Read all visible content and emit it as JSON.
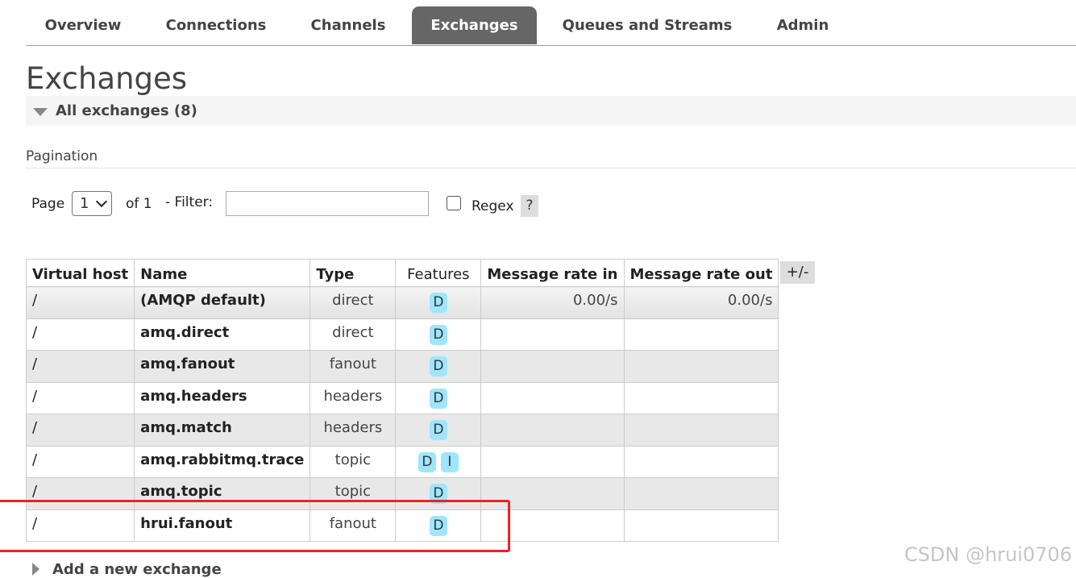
{
  "nav": {
    "tabs": [
      {
        "label": "Overview",
        "active": false
      },
      {
        "label": "Connections",
        "active": false
      },
      {
        "label": "Channels",
        "active": false
      },
      {
        "label": "Exchanges",
        "active": true
      },
      {
        "label": "Queues and Streams",
        "active": false
      },
      {
        "label": "Admin",
        "active": false
      }
    ]
  },
  "page": {
    "title": "Exchanges",
    "section_label": "All exchanges (8)"
  },
  "pagination": {
    "heading": "Pagination",
    "page_label": "Page",
    "page_value": "1",
    "of_label": "of 1",
    "filter_label": "- Filter:",
    "filter_value": "",
    "regex_label": "Regex",
    "regex_checked": false,
    "help_label": "?"
  },
  "table": {
    "headers": {
      "vhost": "Virtual host",
      "name": "Name",
      "type": "Type",
      "features": "Features",
      "rate_in": "Message rate in",
      "rate_out": "Message rate out"
    },
    "columns_toggle": "+/-",
    "rows": [
      {
        "vhost": "/",
        "name": "(AMQP default)",
        "type": "direct",
        "features": [
          "D"
        ],
        "rate_in": "0.00/s",
        "rate_out": "0.00/s"
      },
      {
        "vhost": "/",
        "name": "amq.direct",
        "type": "direct",
        "features": [
          "D"
        ],
        "rate_in": "",
        "rate_out": ""
      },
      {
        "vhost": "/",
        "name": "amq.fanout",
        "type": "fanout",
        "features": [
          "D"
        ],
        "rate_in": "",
        "rate_out": ""
      },
      {
        "vhost": "/",
        "name": "amq.headers",
        "type": "headers",
        "features": [
          "D"
        ],
        "rate_in": "",
        "rate_out": ""
      },
      {
        "vhost": "/",
        "name": "amq.match",
        "type": "headers",
        "features": [
          "D"
        ],
        "rate_in": "",
        "rate_out": ""
      },
      {
        "vhost": "/",
        "name": "amq.rabbitmq.trace",
        "type": "topic",
        "features": [
          "D",
          "I"
        ],
        "rate_in": "",
        "rate_out": ""
      },
      {
        "vhost": "/",
        "name": "amq.topic",
        "type": "topic",
        "features": [
          "D"
        ],
        "rate_in": "",
        "rate_out": ""
      },
      {
        "vhost": "/",
        "name": "hrui.fanout",
        "type": "fanout",
        "features": [
          "D"
        ],
        "rate_in": "",
        "rate_out": ""
      }
    ]
  },
  "footer": {
    "add_exchange_label": "Add a new exchange",
    "watermark": "CSDN @hrui0706"
  },
  "colors": {
    "active_tab_bg": "#666666",
    "feature_badge": "#9fe6fc",
    "highlight_border": "#e22222"
  }
}
